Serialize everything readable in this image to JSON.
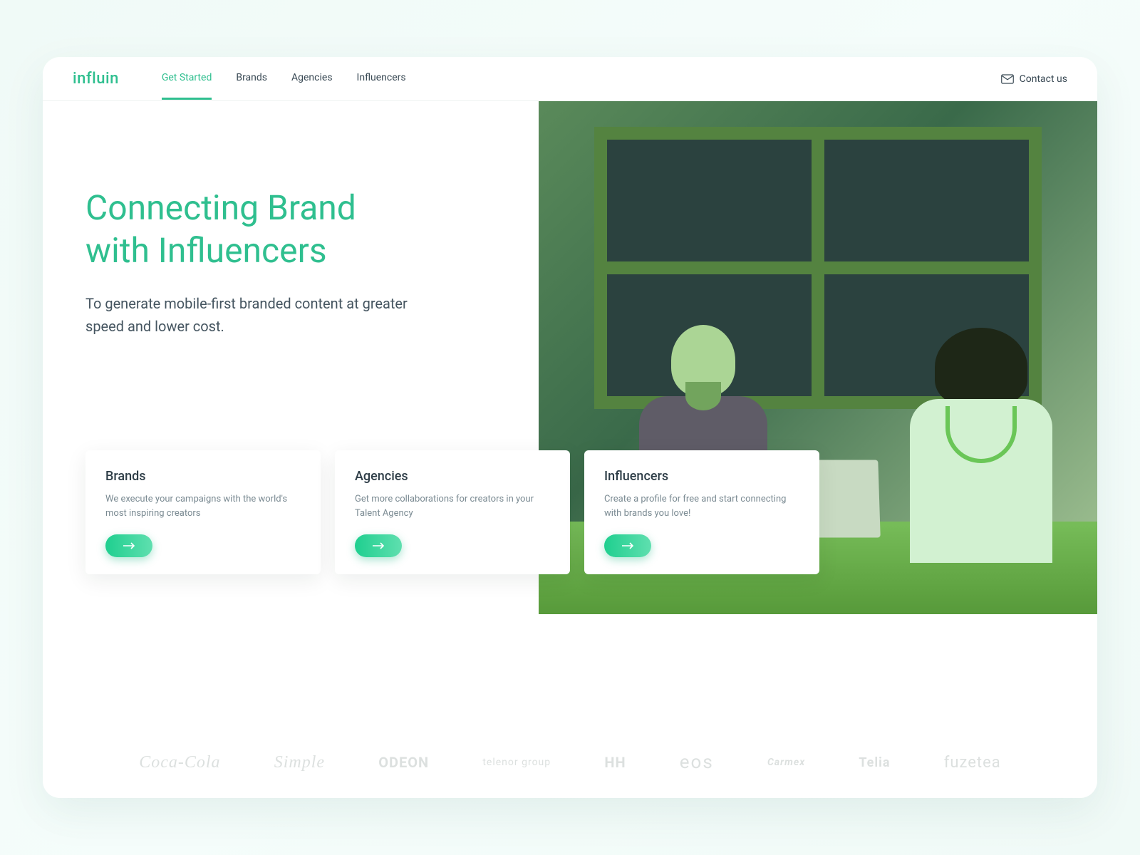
{
  "brand": "influin",
  "nav": {
    "items": [
      {
        "label": "Get Started",
        "active": true
      },
      {
        "label": "Brands",
        "active": false
      },
      {
        "label": "Agencies",
        "active": false
      },
      {
        "label": "Influencers",
        "active": false
      }
    ],
    "contact_label": "Contact us"
  },
  "hero": {
    "headline_line1": "Connecting Brand",
    "headline_line2": "with Influencers",
    "subhead": "To generate mobile-first branded content at greater speed and lower cost."
  },
  "cards": [
    {
      "title": "Brands",
      "desc": "We execute your campaigns with the world's most inspiring creators"
    },
    {
      "title": "Agencies",
      "desc": "Get more collaborations for creators in your Talent Agency"
    },
    {
      "title": "Influencers",
      "desc": "Create a profile for free and start connecting with brands you love!"
    }
  ],
  "logos": [
    "Coca-Cola",
    "Simple",
    "ODEON",
    "telenor group",
    "HH",
    "eos",
    "Carmex",
    "Telia",
    "fuzetea"
  ]
}
